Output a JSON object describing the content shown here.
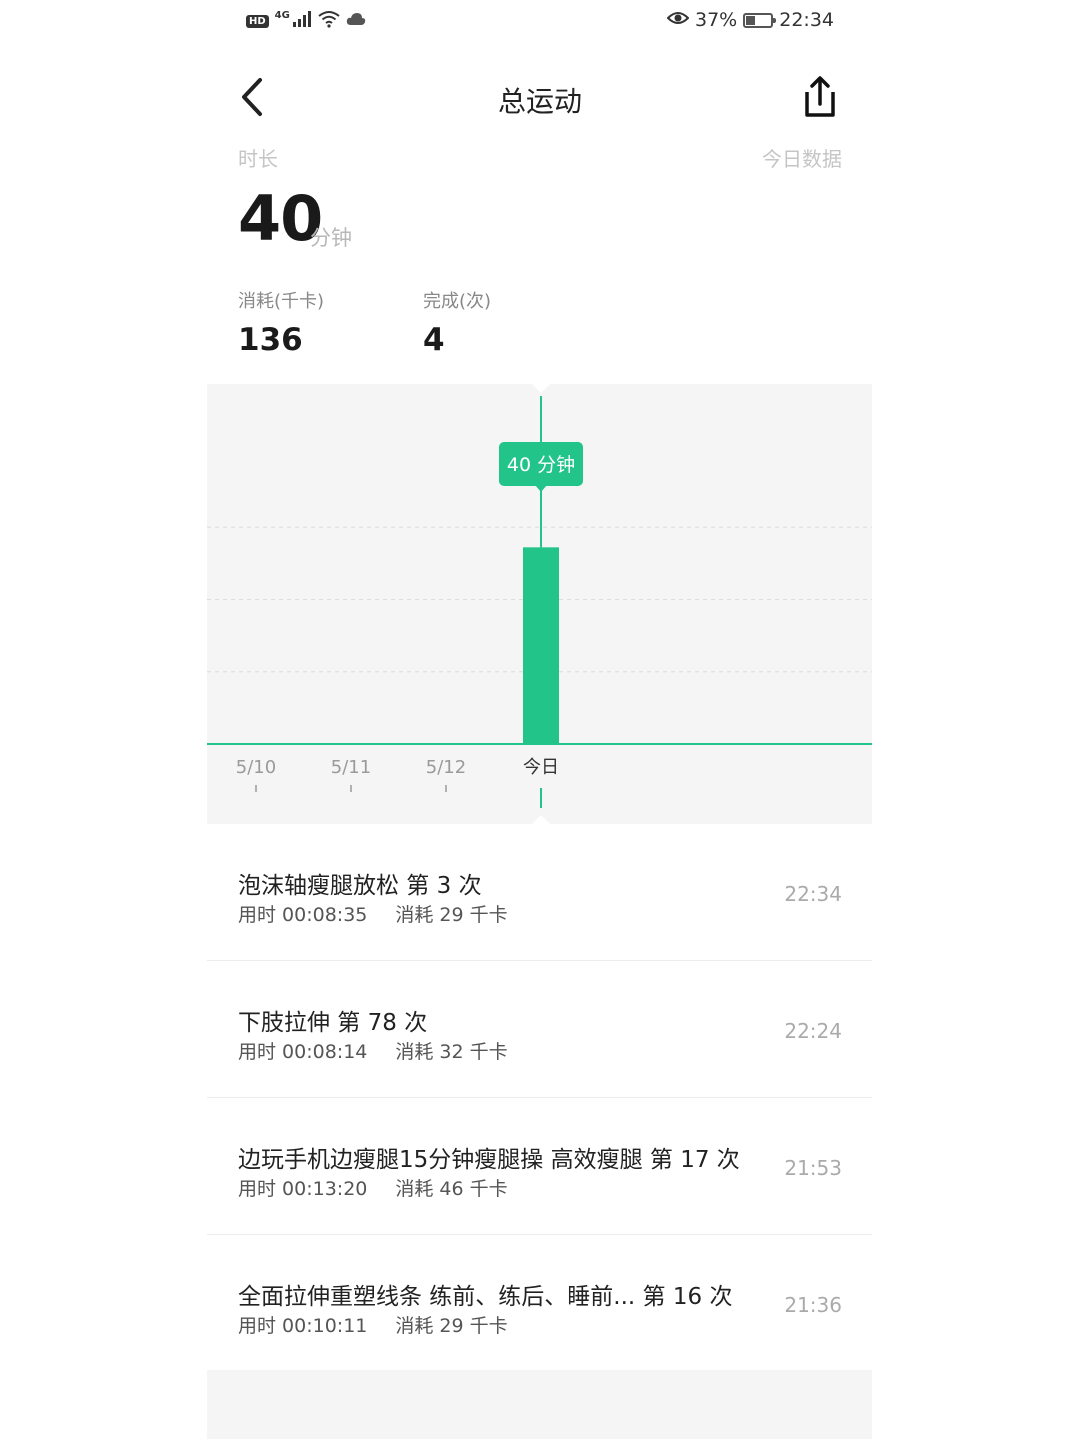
{
  "status_bar": {
    "hd": "HD",
    "network": "4G",
    "battery_percent": "37%",
    "battery_level": 0.37,
    "time": "22:34",
    "icons": [
      "signal-icon",
      "wifi-icon",
      "cloud-icon",
      "eye-icon",
      "battery-icon"
    ]
  },
  "header": {
    "title": "总运动",
    "back_icon": "chevron-left-icon",
    "share_icon": "share-icon"
  },
  "summary": {
    "duration_label": "时长",
    "today_label": "今日数据",
    "duration_value": "40",
    "duration_unit": "分钟",
    "calories_label": "消耗(千卡)",
    "calories_value": "136",
    "completed_label": "完成(次)",
    "completed_value": "4"
  },
  "chart_data": {
    "type": "bar",
    "categories": [
      "5/10",
      "5/11",
      "5/12",
      "今日"
    ],
    "values": [
      0,
      0,
      0,
      40
    ],
    "unit": "分钟",
    "selected_index": 3,
    "tooltip": "40 分钟",
    "ylim": [
      0,
      60
    ],
    "grid": true,
    "bar_color": "#22c48a"
  },
  "records": [
    {
      "title": "泡沫轴瘦腿放松 第 3 次",
      "duration": "用时 00:08:35",
      "calories": "消耗 29 千卡",
      "time": "22:34"
    },
    {
      "title": "下肢拉伸 第 78 次",
      "duration": "用时 00:08:14",
      "calories": "消耗 32 千卡",
      "time": "22:24"
    },
    {
      "title": "边玩手机边瘦腿15分钟瘦腿操 高效瘦腿 第 17 次",
      "duration": "用时 00:13:20",
      "calories": "消耗 46 千卡",
      "time": "21:53"
    },
    {
      "title": "全面拉伸重塑线条 练前、练后、睡前...   第 16 次",
      "duration": "用时 00:10:11",
      "calories": "消耗 29 千卡",
      "time": "21:36"
    }
  ],
  "bottom": {
    "label": ""
  }
}
